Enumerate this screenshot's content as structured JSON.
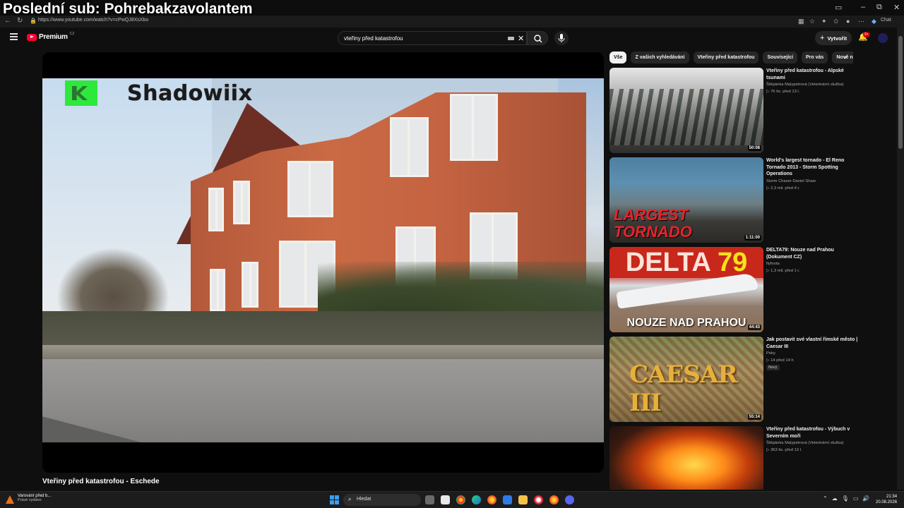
{
  "overlay_title": "Poslední sub: Pohrebakzavolantem",
  "browser": {
    "url": "https://www.youtube.com/watch?v=cPwQJ8XsXbo",
    "chat_label": "Chat"
  },
  "header": {
    "logo_text": "Premium",
    "logo_region": "CZ",
    "search_value": "vteřiny před katastrofou",
    "create_label": "Vytvořit",
    "notifications_badge": "9+"
  },
  "player": {
    "watermark": "Shadowiix",
    "title": "Vteřiny před katastrofou - Eschede"
  },
  "chips": [
    "Vše",
    "Z vašich vyhledávání",
    "Vteřiny před katastrofou",
    "Související",
    "Pro vás",
    "Nově nahráno"
  ],
  "recommendations": [
    {
      "title": "Vteřiny před katastrofou - Alpské tsunami",
      "channel": "Štěpánka Malypetrová (Veterinární služba)",
      "meta": "▷ 76 tis.  před 13 l.",
      "duration": "50:08"
    },
    {
      "title": "World's largest tornado - El Reno Tornado 2013 - Storm Spotting Operations",
      "channel": "Storm Chaser Daniel Shaw",
      "meta": "▷ 2,3 mil.  před 4 r.",
      "duration": "1:11:00",
      "thumb_text_1": "LARGEST",
      "thumb_text_2": "TORNADO"
    },
    {
      "title": "DELTA79: Nouze nad Prahou (Dokument CZ)",
      "channel": "flyfoota",
      "meta": "▷ 1,3 mil.  před 1 r.",
      "duration": "44:43",
      "thumb_top_a": "DELTA ",
      "thumb_top_b": "79",
      "thumb_bottom": "NOUZE NAD PRAHOU"
    },
    {
      "title": "Jak postavit své vlastní římské město | Caesar III",
      "channel": "Peky",
      "meta": "▷ 14  před 14 h",
      "badge": "Nový",
      "duration": "55:14",
      "thumb_logo": "CAESAR III"
    },
    {
      "title": "Vteřiny před katastrofou - Výbuch v Severním moři",
      "channel": "Štěpánka Malypetrová (Veterinární služba)",
      "meta": "▷ 363 tis.  před 13 l."
    }
  ],
  "taskbar": {
    "notif_title": "Varování před b...",
    "notif_sub": "Právě vydáno",
    "search_label": "Hledat",
    "time": "21:34",
    "date": "20.08.2026"
  }
}
